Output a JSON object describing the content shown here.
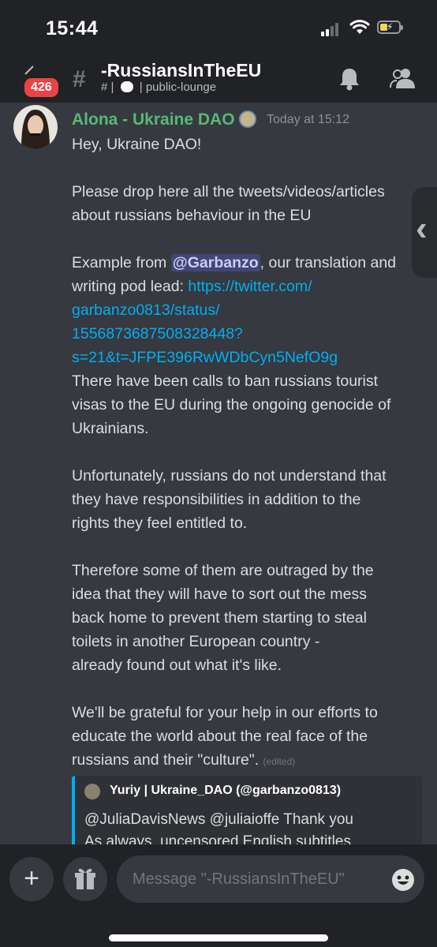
{
  "status_bar": {
    "time": "15:44"
  },
  "header": {
    "unread_count": "426",
    "channel_name": "-RussiansInTheEU",
    "channel_path_prefix": "# |",
    "channel_path_suffix": "| public-lounge"
  },
  "message": {
    "author": "Alona - Ukraine DAO",
    "timestamp": "Today at 15:12",
    "greeting": "Hey, Ukraine DAO!",
    "para1_line1": "Please drop here all the tweets/videos/articles",
    "para1_line2": "about russians behaviour in the EU",
    "example_prefix": "Example from ",
    "mention": "@Garbanzo",
    "example_suffix": ", our translation and",
    "writing_prefix": "writing pod lead: ",
    "link_line1": "https://twitter.com/",
    "link_line2": "garbanzo0813/status/",
    "link_line3": "1556873687508328448?",
    "link_line4": "s=21&t=JFPE396RwWDbCyn5NefO9g",
    "p2_line1": "There have been calls to ban russians tourist",
    "p2_line2": "visas to the EU during the ongoing genocide of",
    "p2_line3": "Ukrainians.",
    "p3_line1": "Unfortunately, russians do not understand that",
    "p3_line2": "they have responsibilities in addition to the",
    "p3_line3": "rights they feel entitled to.",
    "p4_line1": "Therefore some of them are outraged by the",
    "p4_line2": "idea that they will have to sort out the mess",
    "p4_line3": "back home to prevent them starting to steal",
    "p4_line4": "toilets in another European country - ",
    "p4_line5": "already found out what it's like.",
    "p5_line1": "We'll be grateful for your help in our efforts to",
    "p5_line2": "educate the world about the real face of the",
    "p5_line3": "russians and their \"culture\".",
    "edited": "(edited)"
  },
  "embed": {
    "author": "Yuriy | Ukraine_DAO (@garbanzo0813)",
    "text_line1": "@JuliaDavisNews @juliaioffe Thank you",
    "text_line2": "As always, uncensored English subtitles"
  },
  "composer": {
    "placeholder": "Message \"-RussiansInTheEU\"",
    "value": ""
  },
  "colors": {
    "background": "#36393f",
    "bars": "#202225",
    "author_green": "#57b978",
    "link_blue": "#00aff4",
    "badge_red": "#ed4245"
  }
}
